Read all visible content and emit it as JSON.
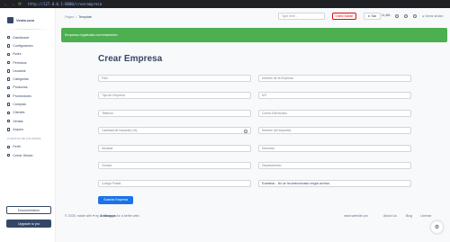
{
  "browser": {
    "url": "http://127.0.0.1:8000/crearempresa"
  },
  "sidebar": {
    "brand": "Venta.com",
    "items": [
      {
        "label": "Dashboard",
        "icon": "dashboard-icon"
      },
      {
        "label": "Configuracion",
        "icon": "settings-icon"
      },
      {
        "label": "Roles",
        "icon": "roles-icon"
      },
      {
        "label": "Permisos",
        "icon": "permissions-icon"
      },
      {
        "label": "Usuarios",
        "icon": "users-icon"
      },
      {
        "label": "Categorias",
        "icon": "categories-icon"
      },
      {
        "label": "Productos",
        "icon": "products-icon"
      },
      {
        "label": "Proveedores",
        "icon": "suppliers-icon"
      },
      {
        "label": "Compras",
        "icon": "purchases-icon"
      },
      {
        "label": "Clientes",
        "icon": "clients-icon"
      },
      {
        "label": "Ventas",
        "icon": "sales-icon"
      },
      {
        "label": "Arqueo",
        "icon": "cash-icon"
      }
    ],
    "section_title": "CUENTAS DE USUARIOS",
    "account_items": [
      {
        "label": "Perfil",
        "icon": "profile-icon"
      },
      {
        "label": "Cerrar Sesion",
        "icon": "logout-icon"
      }
    ],
    "documentation": "Documentation",
    "upgrade": "Upgrade to pro"
  },
  "header": {
    "breadcrumb_root": "Pages",
    "breadcrumb_sep": "/",
    "breadcrumb_current": "Template",
    "search_placeholder": "Type here...",
    "online_builder": "Online Builder",
    "star_label": "Star",
    "star_count": "11,464",
    "signout": "Cerrar sesión"
  },
  "alert": {
    "message": "Empresa registrada correctamente."
  },
  "form": {
    "title": "Crear Empresa",
    "fields": {
      "pais": "País",
      "nombre": "Nombre de la Empresa",
      "tipo": "Tipo de Empresa",
      "nit": "NIT",
      "telefono": "Teléfono",
      "correo": "Correo Electronico",
      "cantidad": "Cantidad de Impuesto (%)",
      "nombre_impuesto": "Nombre del Impuesto",
      "moneda": "Moneda",
      "direccion": "Dirección",
      "ciudad": "Ciudad",
      "departamento": "Departamento",
      "codigo_postal": "Codigo Postal"
    },
    "file_button": "Examinar...",
    "file_status": "No se ha seleccionado ningún archivo.",
    "submit": "Guardar Empresa"
  },
  "footer": {
    "copyright": "© 2025, made with",
    "heart": "♥",
    "by": "by",
    "author": "Anttaappa",
    "suffix": "for a better web.",
    "links": [
      "www.website.pro",
      "About Us",
      "Blog",
      "License"
    ]
  },
  "colors": {
    "primary": "#1a73e8",
    "success": "#4caf50",
    "dark": "#344767",
    "danger": "#ea0606"
  }
}
